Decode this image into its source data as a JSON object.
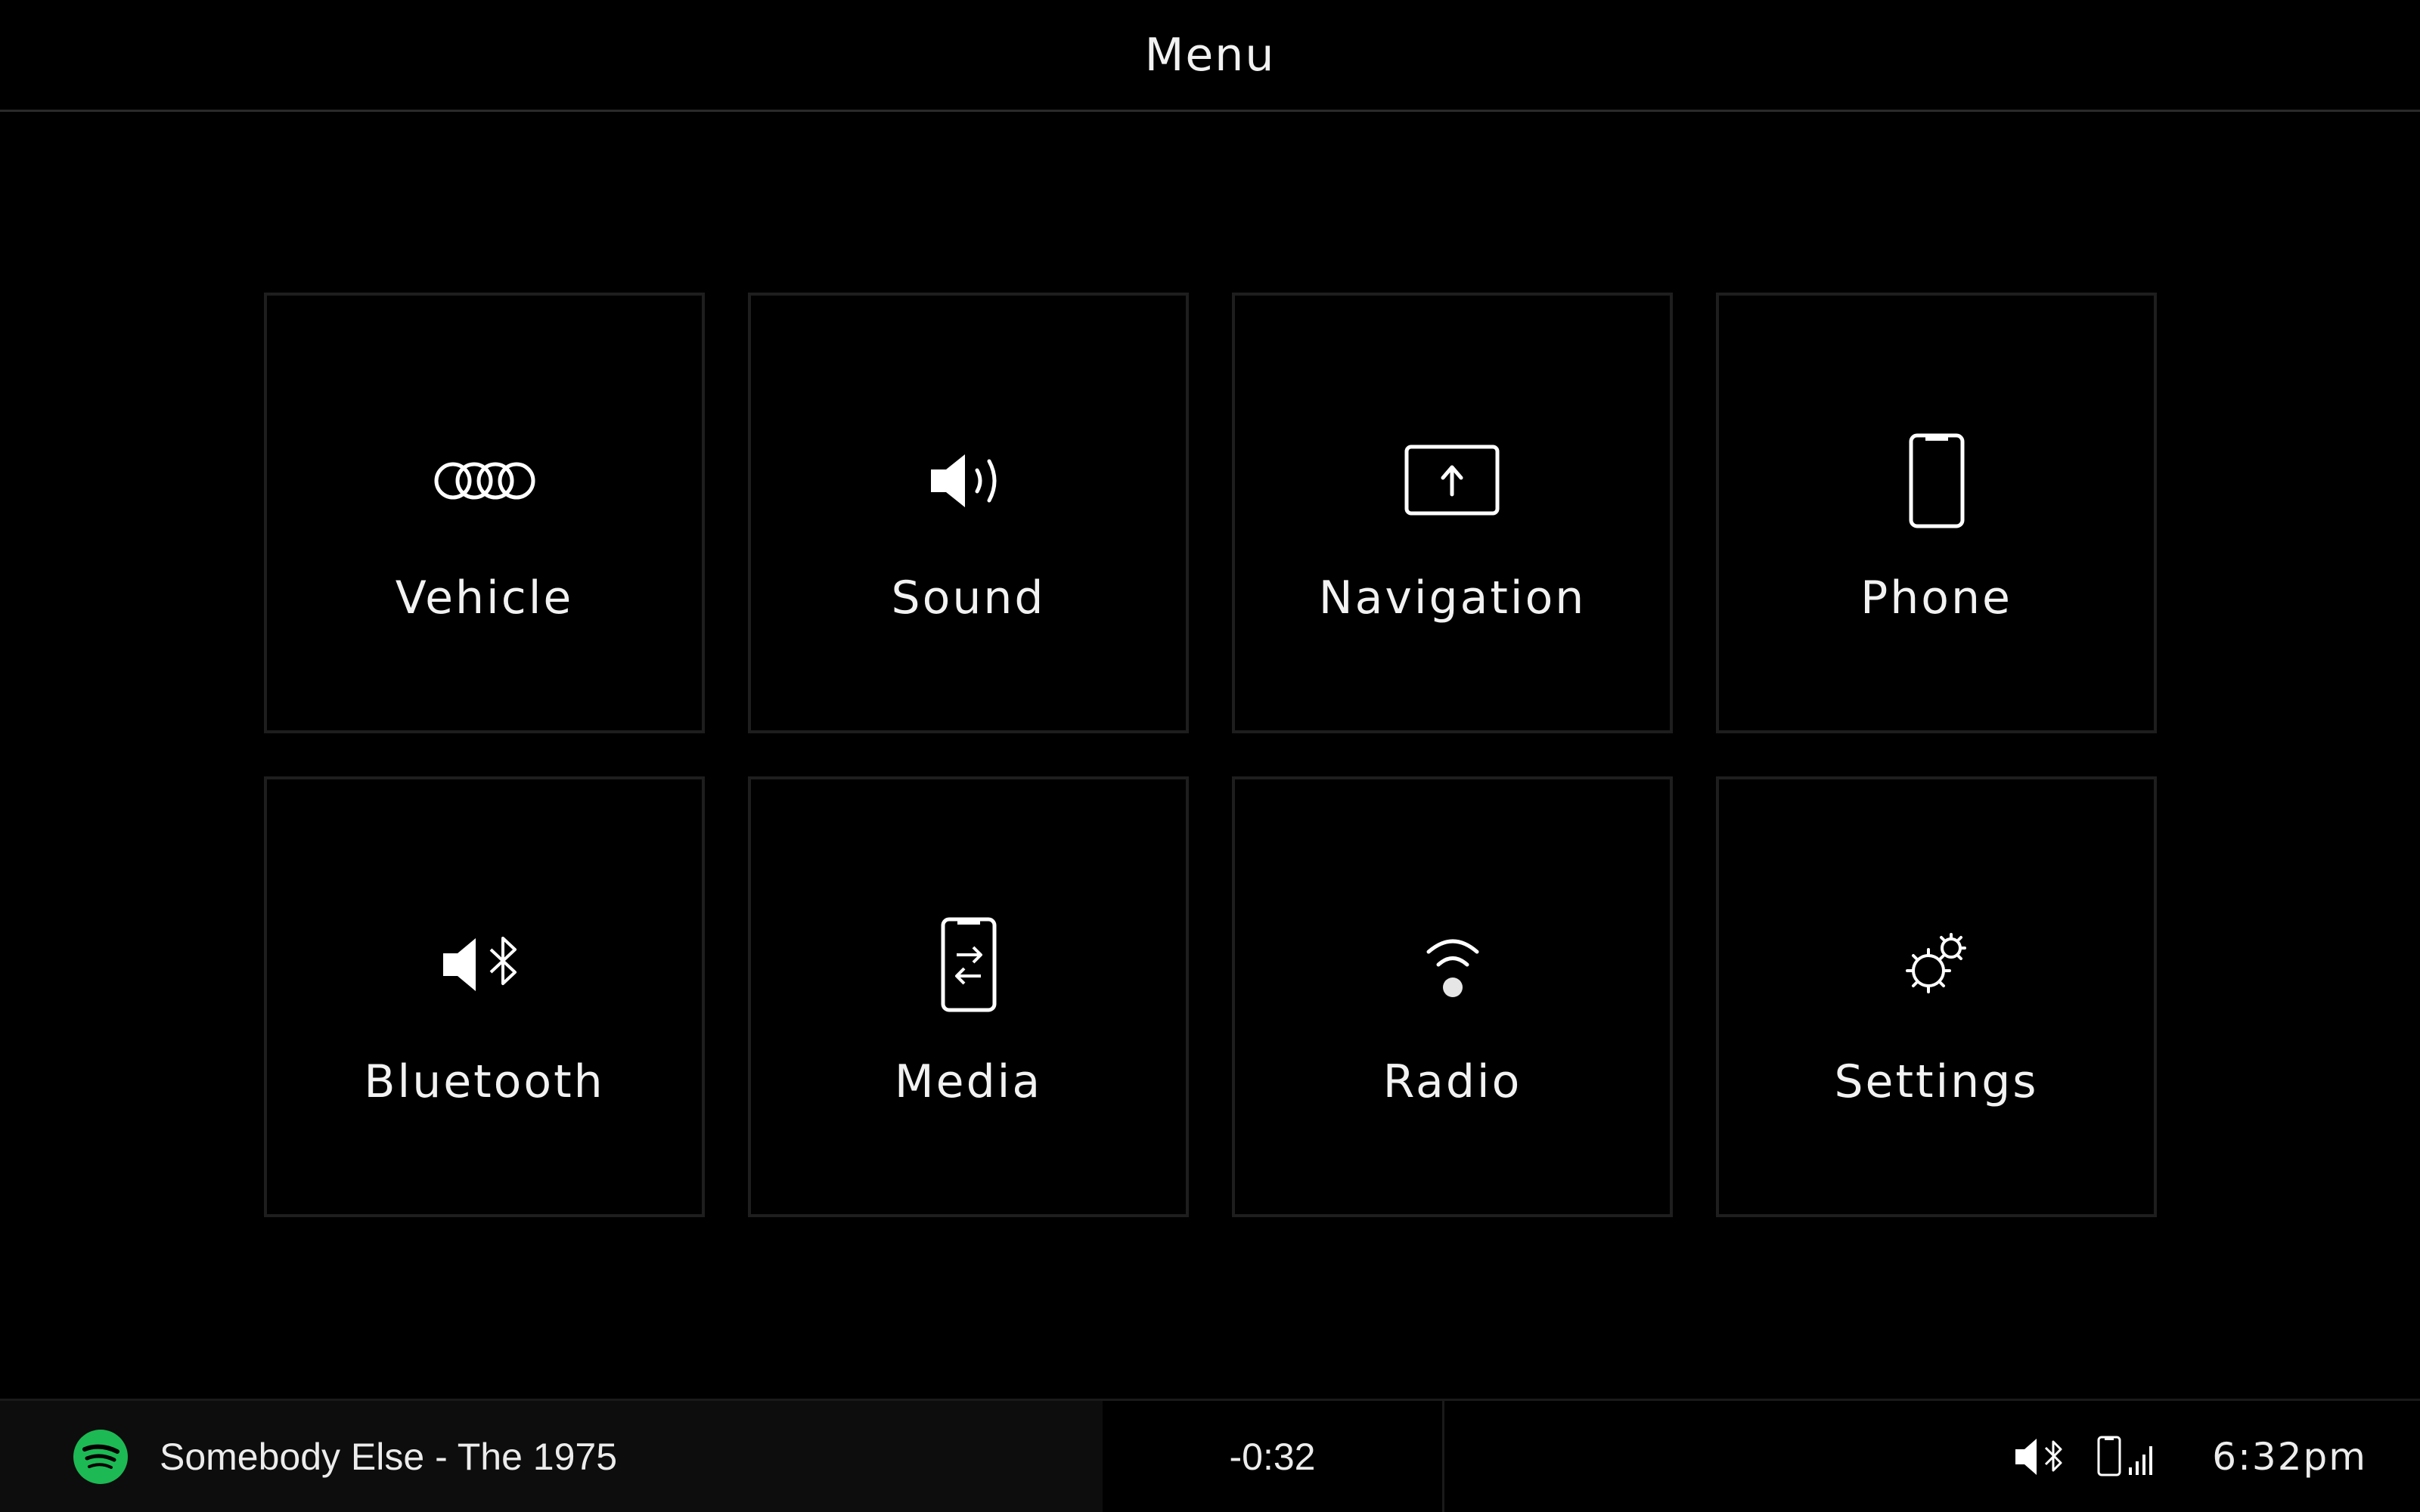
{
  "header": {
    "title": "Menu"
  },
  "menu": {
    "items": [
      {
        "label": "Vehicle",
        "icon": "vehicle-rings-icon"
      },
      {
        "label": "Sound",
        "icon": "speaker-icon"
      },
      {
        "label": "Navigation",
        "icon": "navigation-arrow-icon"
      },
      {
        "label": "Phone",
        "icon": "phone-icon"
      },
      {
        "label": "Bluetooth",
        "icon": "bluetooth-audio-icon"
      },
      {
        "label": "Media",
        "icon": "media-transfer-icon"
      },
      {
        "label": "Radio",
        "icon": "radio-signal-icon"
      },
      {
        "label": "Settings",
        "icon": "settings-gear-icon"
      }
    ]
  },
  "now_playing": {
    "app_icon": "spotify-icon",
    "track": "Somebody Else - The 1975",
    "time_remaining": "-0:32"
  },
  "status": {
    "icons": [
      "mute-bluetooth-icon",
      "phone-signal-icon"
    ],
    "clock": "6:32pm"
  },
  "colors": {
    "background": "#000000",
    "text": "#ffffff",
    "tile_border": "#1e1e1e",
    "spotify_green": "#1DB954"
  }
}
